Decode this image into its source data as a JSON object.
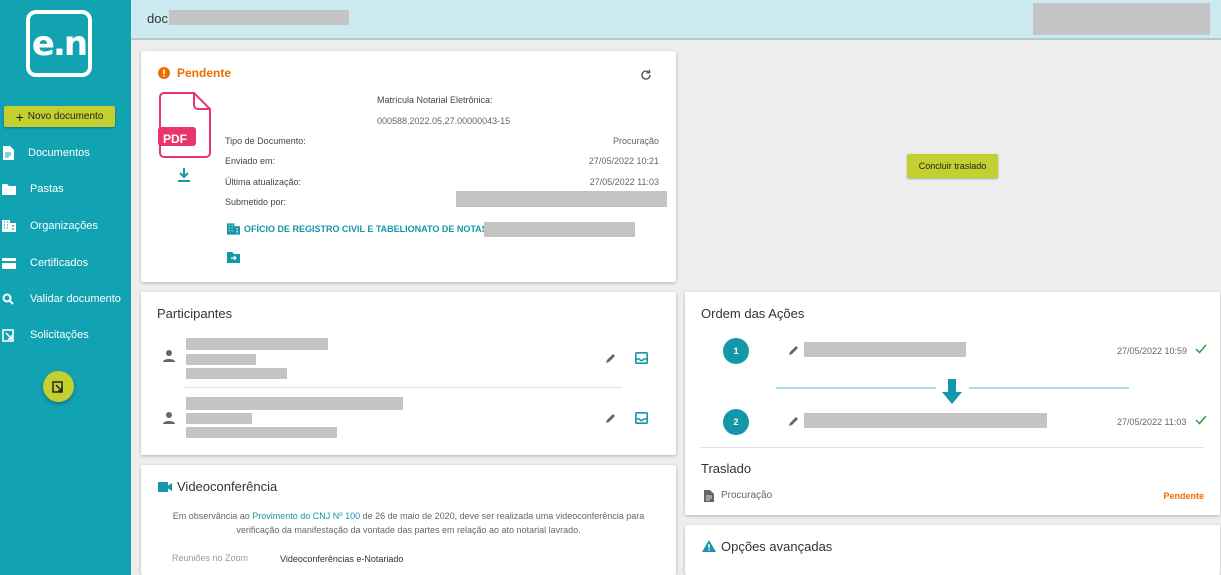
{
  "sidebar": {
    "logo": "e.n",
    "new_document": "Novo documento",
    "items": [
      {
        "label": "Documentos",
        "icon": "document-icon"
      },
      {
        "label": "Pastas",
        "icon": "folder-icon"
      },
      {
        "label": "Organizações",
        "icon": "building-icon"
      },
      {
        "label": "Certificados",
        "icon": "card-icon"
      },
      {
        "label": "Validar documento",
        "icon": "search-check-icon"
      },
      {
        "label": "Solicitações",
        "icon": "inbox-icon"
      }
    ]
  },
  "header": {
    "doc_prefix": "doc"
  },
  "document": {
    "status": "Pendente",
    "file_type": "PDF",
    "registry_label": "Matrícula Notarial Eletrônica:",
    "registry_value": "000588.2022.05.27.00000043-15",
    "fields": [
      {
        "label": "Tipo de Documento:",
        "value": "Procuração"
      },
      {
        "label": "Enviado em:",
        "value": "27/05/2022 10:21"
      },
      {
        "label": "Última atualização:",
        "value": "27/05/2022 11:03"
      },
      {
        "label": "Submetido por:",
        "value": ""
      }
    ],
    "organization": "OFÍCIO DE REGISTRO CIVIL E TABELIONATO DE NOTAS DE"
  },
  "conclude_button": "Concluir traslado",
  "participants": {
    "title": "Participantes"
  },
  "video": {
    "title": "Videoconferência",
    "text_before": "Em observância ao ",
    "link": "Provimento do CNJ Nº 100",
    "text_after": " de 26 de maio de 2020, deve ser realizada uma videoconferência para",
    "text_line2": "verificação da manifestação da vontade das partes em relação ao ato notarial lavrado.",
    "zoom_label": "Reuniões no Zoom",
    "enotariado_label": "Videoconferências e-Notariado"
  },
  "actions": {
    "title": "Ordem das Ações",
    "steps": [
      {
        "number": "1",
        "time": "27/05/2022 10:59"
      },
      {
        "number": "2",
        "time": "27/05/2022 11:03"
      }
    ],
    "traslado_title": "Traslado",
    "traslado_item": "Procuração",
    "traslado_status": "Pendente"
  },
  "advanced": {
    "title": "Opções avançadas"
  },
  "colors": {
    "teal": "#12a3b3",
    "lime": "#c4d02f",
    "orange": "#ef6c00",
    "pdf_red": "#e8356b"
  }
}
